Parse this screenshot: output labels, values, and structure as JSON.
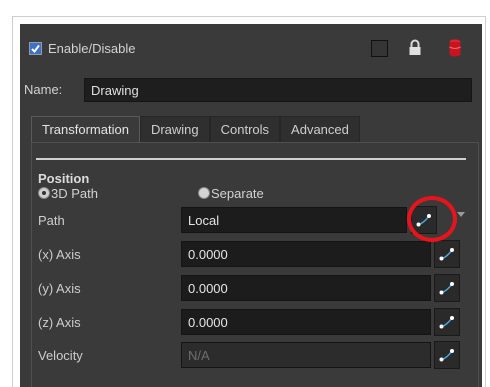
{
  "header": {
    "enable_label": "Enable/Disable",
    "enable_checked": true
  },
  "name": {
    "label": "Name:",
    "value": "Drawing"
  },
  "tabs": [
    {
      "label": "Transformation",
      "active": true
    },
    {
      "label": "Drawing",
      "active": false
    },
    {
      "label": "Controls",
      "active": false
    },
    {
      "label": "Advanced",
      "active": false
    }
  ],
  "position": {
    "title": "Position",
    "radio_3d_label": "3D Path",
    "radio_separate_label": "Separate",
    "selected": "3D Path"
  },
  "rows": {
    "path": {
      "label": "Path",
      "value": "Local"
    },
    "x_axis": {
      "label": "(x) Axis",
      "value": "0.0000"
    },
    "y_axis": {
      "label": "(y) Axis",
      "value": "0.0000"
    },
    "z_axis": {
      "label": "(z) Axis",
      "value": "0.0000"
    },
    "velocity": {
      "label": "Velocity",
      "value": "N/A"
    }
  },
  "colors": {
    "panel": "#3a3a3a",
    "field": "#1c1c1c",
    "highlight": "#e8141c",
    "function_curve": "#4aa8e0"
  },
  "icons": [
    "checkbox-icon",
    "square-icon",
    "lock-icon",
    "database-icon",
    "function-curve-icon"
  ]
}
